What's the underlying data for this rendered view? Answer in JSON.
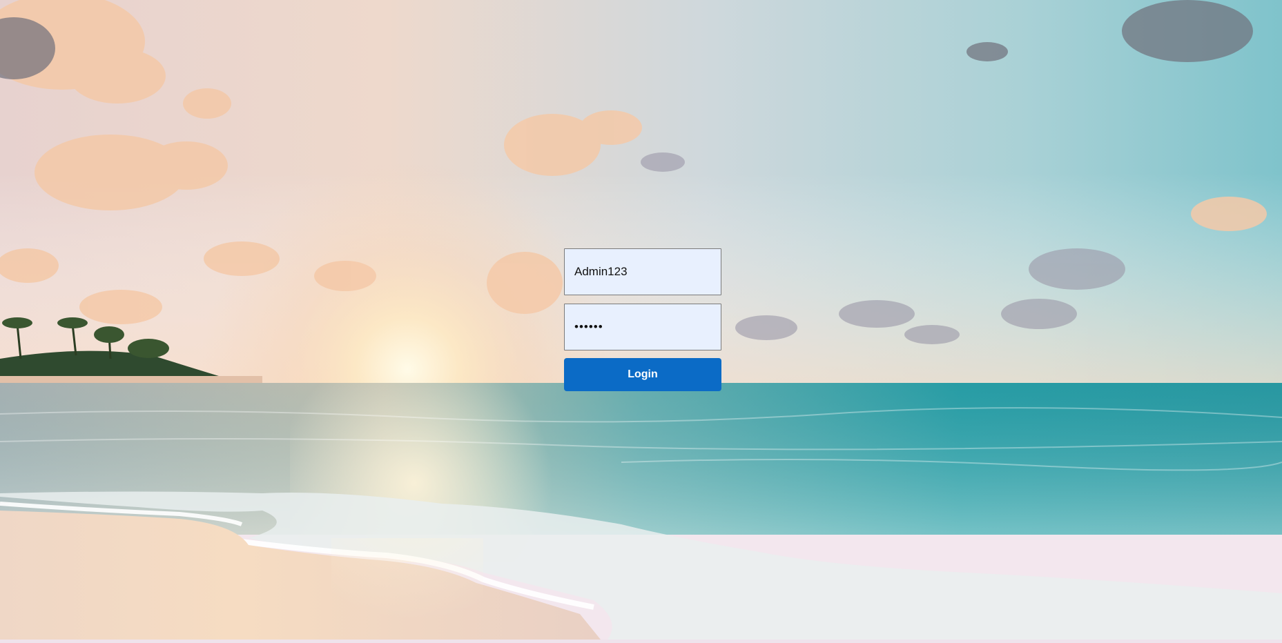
{
  "login": {
    "username_value": "Admin123",
    "password_value": "123456",
    "button_label": "Login"
  },
  "background": {
    "scene": "beach-sunset-image"
  },
  "colors": {
    "button": "#0b6bc6",
    "field_bg": "#e8f0fe",
    "sky_top": "#c9d4dc",
    "sea": "#2aa0a8"
  }
}
